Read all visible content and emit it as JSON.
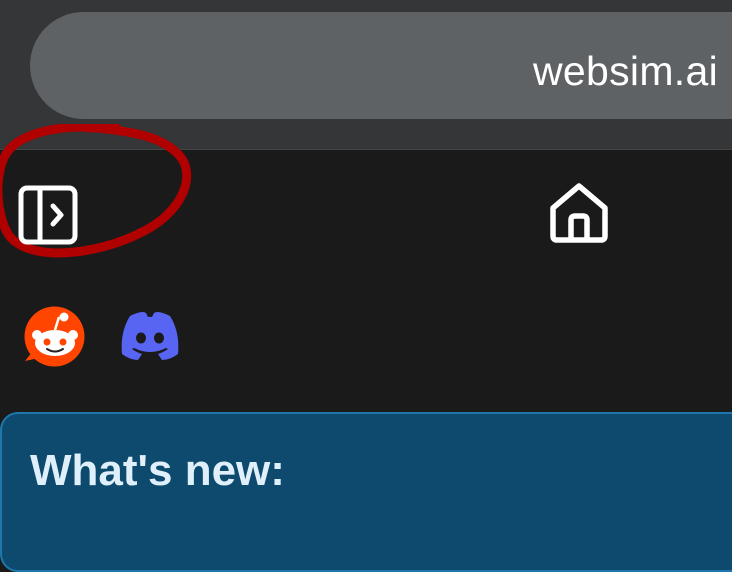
{
  "browser": {
    "url": "websim.ai"
  },
  "toolbar": {
    "sidebar_toggle_icon": "sidebar-expand-icon",
    "home_icon": "home-icon"
  },
  "social": {
    "reddit_icon": "reddit-icon",
    "discord_icon": "discord-icon"
  },
  "whats_new": {
    "title": "What's new:"
  },
  "colors": {
    "browser_bar": "#343638",
    "url_bar": "#5f6265",
    "page_bg": "#1a1a1a",
    "card_bg": "#0d4a6e",
    "card_border": "#1f78ab",
    "annotation": "#b00000",
    "reddit": "#ff4500",
    "discord": "#5865f2"
  }
}
